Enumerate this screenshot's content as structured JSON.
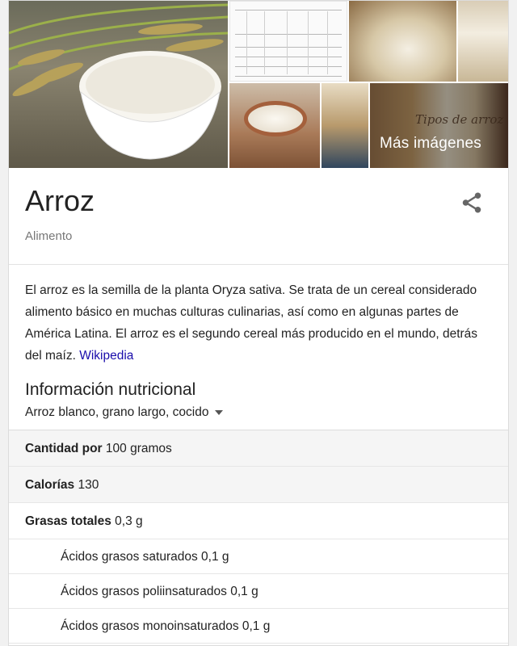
{
  "images": {
    "more_label": "Más imágenes",
    "tipos_label": "Tipos de arroz"
  },
  "header": {
    "title": "Arroz",
    "subtitle": "Alimento"
  },
  "description": {
    "text": "El arroz  es la semilla de la planta Oryza sativa. Se trata de un cereal considerado alimento básico en muchas culturas culinarias, así como en algunas partes de América Latina. El arroz es el segundo cereal más producido en el mundo, detrás del maíz. ",
    "source_link": "Wikipedia"
  },
  "nutrition": {
    "title": "Información nutricional",
    "selected_option": "Arroz blanco, grano largo, cocido",
    "rows": [
      {
        "label": "Cantidad por",
        "value": "100 gramos"
      },
      {
        "label": "Calorías",
        "value": "130"
      },
      {
        "label": "Grasas totales",
        "value": "0,3 g"
      },
      {
        "label": "",
        "value": "Ácidos grasos saturados 0,1 g"
      },
      {
        "label": "",
        "value": "Ácidos grasos poliinsaturados 0,1 g"
      },
      {
        "label": "",
        "value": "Ácidos grasos monoinsaturados 0,1 g"
      }
    ]
  },
  "colors": {
    "link": "#1a0dab",
    "row_shade": "#f5f5f5"
  }
}
